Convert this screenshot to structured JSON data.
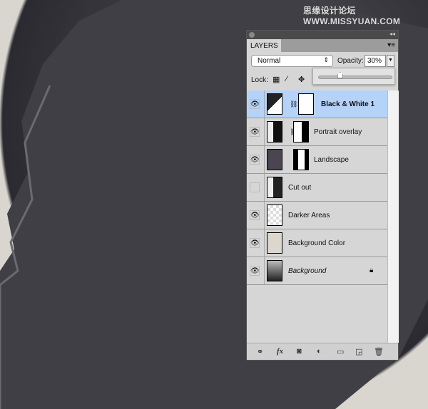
{
  "watermark": "思缘设计论坛 WWW.MISSYUAN.COM",
  "panel": {
    "tab": "LAYERS",
    "blend_mode": "Normal",
    "opacity_label": "Opacity:",
    "opacity_value": "30%",
    "opacity_slider_percent": 30,
    "lock_label": "Lock:",
    "layers": [
      {
        "name": "Black & White 1",
        "visible": true,
        "selected": true,
        "bold": true
      },
      {
        "name": "Portrait overlay",
        "visible": true
      },
      {
        "name": "Landscape",
        "visible": true
      },
      {
        "name": "Cut out",
        "visible": false
      },
      {
        "name": "Darker Areas",
        "visible": true
      },
      {
        "name": "Background Color",
        "visible": true
      },
      {
        "name": "Background",
        "visible": true,
        "italic": true,
        "locked": true
      }
    ],
    "bottom_icons": [
      "link-icon",
      "fx-icon",
      "mask-icon",
      "adjustment-icon",
      "folder-icon",
      "new-layer-icon",
      "trash-icon"
    ]
  },
  "colors": {
    "selected_row": "#b5d3f9",
    "panel": "#d6d6d6",
    "background": "#d9d5cf"
  }
}
